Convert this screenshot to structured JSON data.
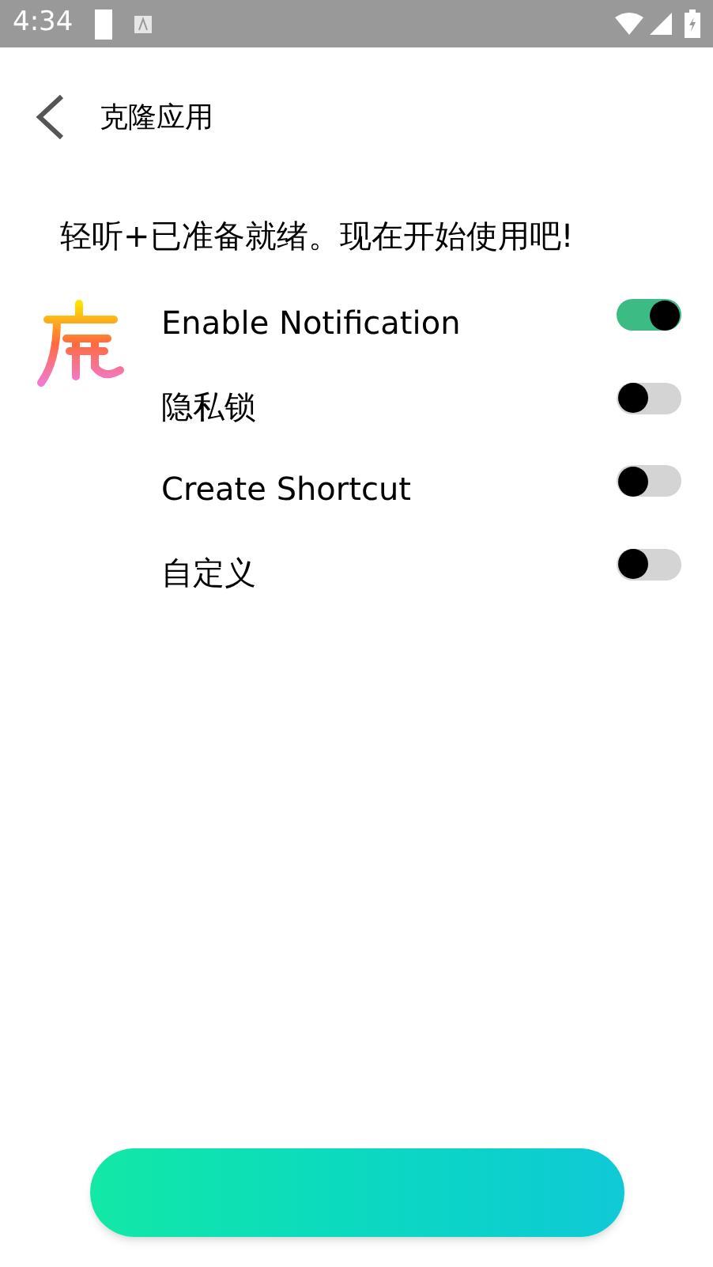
{
  "status_bar": {
    "time": "4:34"
  },
  "header": {
    "title": "克隆应用"
  },
  "message": "轻听+已准备就绪。现在开始使用吧!",
  "options": [
    {
      "label": "Enable Notification",
      "on": true
    },
    {
      "label": "隐私锁",
      "on": false
    },
    {
      "label": "Create Shortcut",
      "on": false
    },
    {
      "label": "自定义",
      "on": false
    }
  ]
}
